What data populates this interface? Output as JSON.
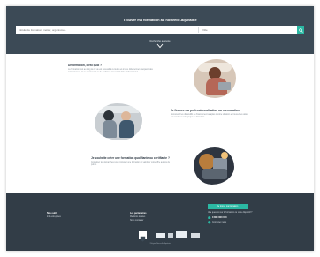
{
  "hero": {
    "title": "Trouver ma formation au nouvelle-aquitaine",
    "search_placeholder": "Intitulé de formation, métier, organisme...",
    "location_placeholder": "Ville",
    "advanced_link": "Recherche avancée"
  },
  "blocks": [
    {
      "title": "Déformation, c'est quoi ?",
      "text": "La formation tout au long de la vie est accessible à toutes et à tous. Elle permet d'acquérir des compétences, de se reconvertir ou de renforcer son savoir-faire professionnel."
    },
    {
      "title": "Je finance ma professionnalisation ou ma mutation",
      "text": "Découvrez les dispositifs de financement adaptés à votre situation et trouvez les aides pour réaliser votre projet de formation."
    },
    {
      "title": "Je souhaite créer une formation qualifiante ou certifiante ?",
      "text": "Consultez les démarches pour proposer une formation et valoriser votre offre auprès du public."
    }
  ],
  "footer": {
    "cta_label": "Je trouve ma formation",
    "col1": {
      "title": "Nos outils",
      "line": "Info entreprises"
    },
    "col2": {
      "title": "Les partenaires",
      "line1": "Mentions légales",
      "line2": "Nous contacter"
    },
    "contact_title": "Une question sur la formation ou votre dispositif ?",
    "phone": "0 800 000 000",
    "contact_link": "Contactez-nous",
    "copyright": "© Région Nouvelle-Aquitaine"
  },
  "colors": {
    "header_bg": "#3c4a56",
    "accent": "#2bb8a3",
    "footer_bg": "#323d47"
  }
}
